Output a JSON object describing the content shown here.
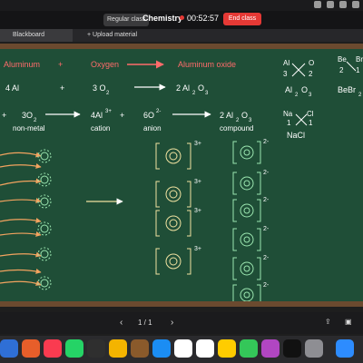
{
  "classbar": {
    "badge": "Regular class",
    "subject": "Chemistry",
    "timer": "00:52:57",
    "end_label": "End class"
  },
  "tabs": [
    {
      "label": "Blackboard"
    },
    {
      "label": "Upload material"
    }
  ],
  "board": {
    "row1": [
      "Aluminum",
      "+",
      "Oxygen",
      "Aluminum oxide"
    ],
    "row2_left": "4 Al",
    "row2_plus": "+",
    "row2_o2": "3 O",
    "row2_o2_sub": "2",
    "row2_prod": "2 Al",
    "row2_prod_sub1": "2",
    "row2_prod_o": "O",
    "row2_prod_sub2": "3",
    "row3_plus": "+",
    "row3_o2": "3O",
    "row3_o2_sub": "2",
    "row3_al": "4Al",
    "row3_al_sup": "3+",
    "row3_o": "6O",
    "row3_o_sup": "2-",
    "row3_prod": "2 Al",
    "row3_prod_sub1": "2",
    "row3_prod_o": "O",
    "row3_prod_sub2": "3",
    "labels": [
      "non-metal",
      "cation",
      "anion",
      "compound"
    ],
    "right_al": "Al",
    "right_o": "O",
    "right_3": "3",
    "right_2": "2",
    "right_formula": "Al",
    "right_formula_sub1": "2",
    "right_formula_o": "O",
    "right_formula_sub2": "3",
    "right_be": "Be",
    "right_br": "Br",
    "right_be_2": "2",
    "right_be_1": "1",
    "right_bebr": "BeBr",
    "right_bebr_sub": "2",
    "right_na": "Na",
    "right_cl": "Cl",
    "right_na_1": "1",
    "right_cl_1": "1",
    "right_nacl": "NaCl",
    "cation_sup": "3+",
    "anion_sup": "2-"
  },
  "pager": "1 / 1",
  "colors": {
    "board": "#1f4e37",
    "chalk_red": "#ff6b6b",
    "chalk_white": "#ffffff",
    "chalk_orange": "#f3a35f",
    "chalk_yellow": "#f0e2a0",
    "chalk_green": "#9be6b0"
  }
}
